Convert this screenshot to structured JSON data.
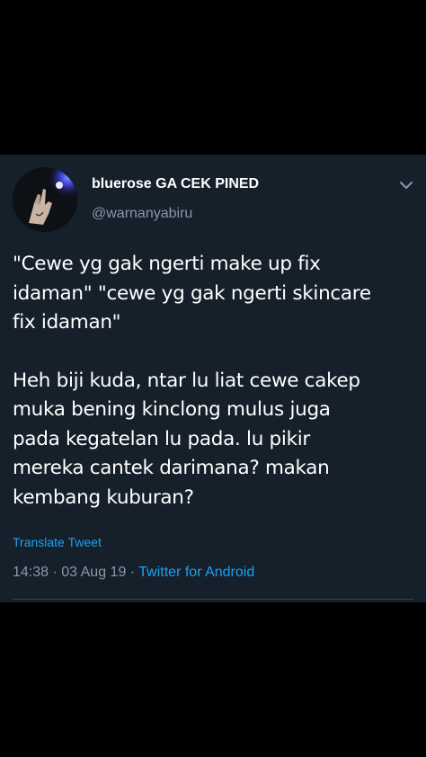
{
  "tweet": {
    "display_name": "bluerose GA CEK PINED",
    "username": "@warnanyabiru",
    "paragraphs": [
      "\"Cewe yg gak ngerti make up fix\nidaman\" \"cewe yg gak ngerti skincare\nfix idaman\"",
      "Heh biji kuda, ntar lu liat cewe cakep\nmuka bening kinclong mulus juga\npada kegatelan lu pada. lu pikir\nmereka cantek darimana? makan\nkembang kuburan?"
    ],
    "translate_label": "Translate Tweet",
    "time": "14:38",
    "separator": " · ",
    "date": "03 Aug 19",
    "source": "Twitter for Android"
  },
  "colors": {
    "background": "#000000",
    "card": "#15202b",
    "text_primary": "#ffffff",
    "text_secondary": "#8899a6",
    "accent": "#1da1f2",
    "divider": "#38444d"
  },
  "icons": {
    "avatar": "avatar-photo",
    "more": "chevron-down-icon"
  }
}
